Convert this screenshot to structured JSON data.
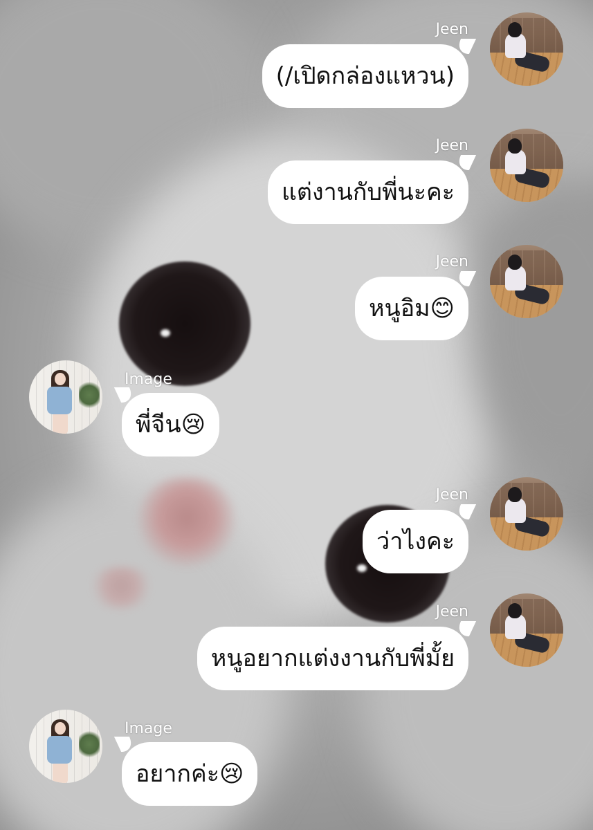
{
  "chat": {
    "messages": [
      {
        "sender": "Jeen",
        "side": "right",
        "text": "(/เปิดกล่องแหวน)",
        "avatar_icon": "jeen-avatar"
      },
      {
        "sender": "Jeen",
        "side": "right",
        "text": "แต่งานกับพี่นะคะ",
        "avatar_icon": "jeen-avatar"
      },
      {
        "sender": "Jeen",
        "side": "right",
        "text": "หนูอิม😊",
        "avatar_icon": "jeen-avatar"
      },
      {
        "sender": "Image",
        "side": "left",
        "text": "พี่จีน😢",
        "avatar_icon": "image-avatar"
      },
      {
        "sender": "Jeen",
        "side": "right",
        "text": "ว่าไงคะ",
        "avatar_icon": "jeen-avatar"
      },
      {
        "sender": "Jeen",
        "side": "right",
        "text": "หนูอยากแต่งงานกับพี่มั้ย",
        "avatar_icon": "jeen-avatar"
      },
      {
        "sender": "Image",
        "side": "left",
        "text": "อยากค่ะ😢",
        "avatar_icon": "image-avatar"
      }
    ]
  },
  "colors": {
    "bubble": "#ffffff",
    "bubble_text": "#111111",
    "name_text": "#ffffff"
  },
  "background": {
    "icon": "blurred-white-kitten-photo"
  }
}
